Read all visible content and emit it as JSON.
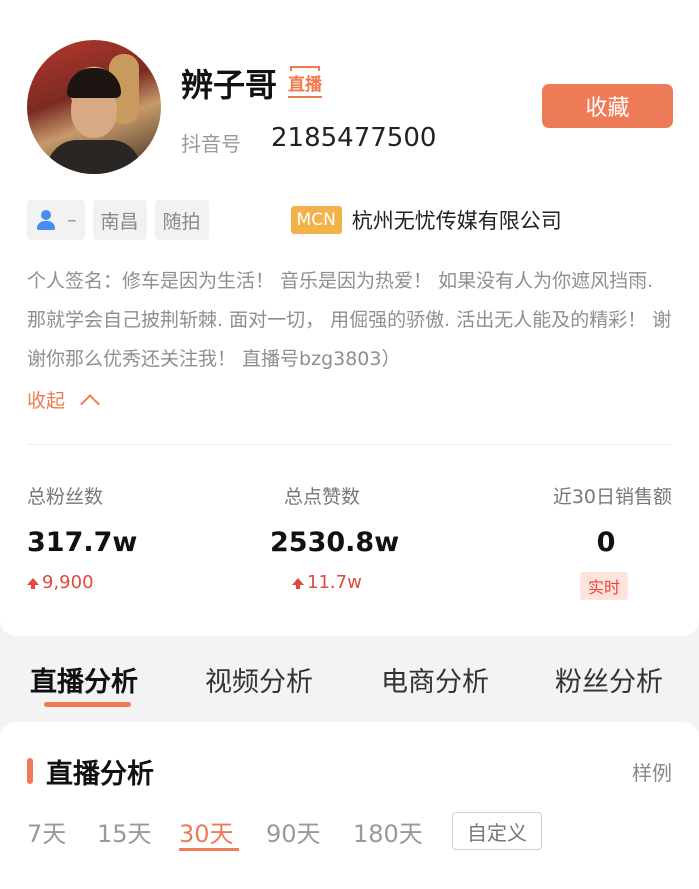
{
  "profile": {
    "nickname": "辨子哥",
    "live_tag": "直播",
    "collect_label": "收藏",
    "douyin_id_label": "抖音号",
    "douyin_id": "2185477500"
  },
  "tags": {
    "gender": "–",
    "city": "南昌",
    "category": "随拍",
    "mcn_badge": "MCN",
    "mcn_name": "杭州无忧传媒有限公司"
  },
  "bio": {
    "text": "个人签名：修车是因为生活！ 音乐是因为热爱！ 如果没有人为你遮风挡雨. 那就学会自己披荆斩棘. 面对一切， 用倔强的骄傲. 活出无人能及的精彩！ 谢谢你那么优秀还关注我！ 直播号bzg3803）",
    "collapse_label": "收起"
  },
  "stats": {
    "fans": {
      "label": "总粉丝数",
      "value": "317.7w",
      "delta": "9,900"
    },
    "likes": {
      "label": "总点赞数",
      "value": "2530.8w",
      "delta": "11.7w"
    },
    "sales": {
      "label": "近30日销售额",
      "value": "0",
      "badge": "实时"
    }
  },
  "tabs": [
    "直播分析",
    "视频分析",
    "电商分析",
    "粉丝分析"
  ],
  "section": {
    "title": "直播分析",
    "sample_label": "样例",
    "ranges": [
      "7天",
      "15天",
      "30天",
      "90天",
      "180天"
    ],
    "active_range": "30天",
    "custom_label": "自定义"
  },
  "colors": {
    "accent": "#ee7b57",
    "up": "#e2483b",
    "mcn": "#f3b247",
    "user_icon": "#4a8df0"
  },
  "icons": {
    "user": "user-icon",
    "chevron": "chevron-up-icon",
    "arrow": "arrow-up-icon"
  }
}
